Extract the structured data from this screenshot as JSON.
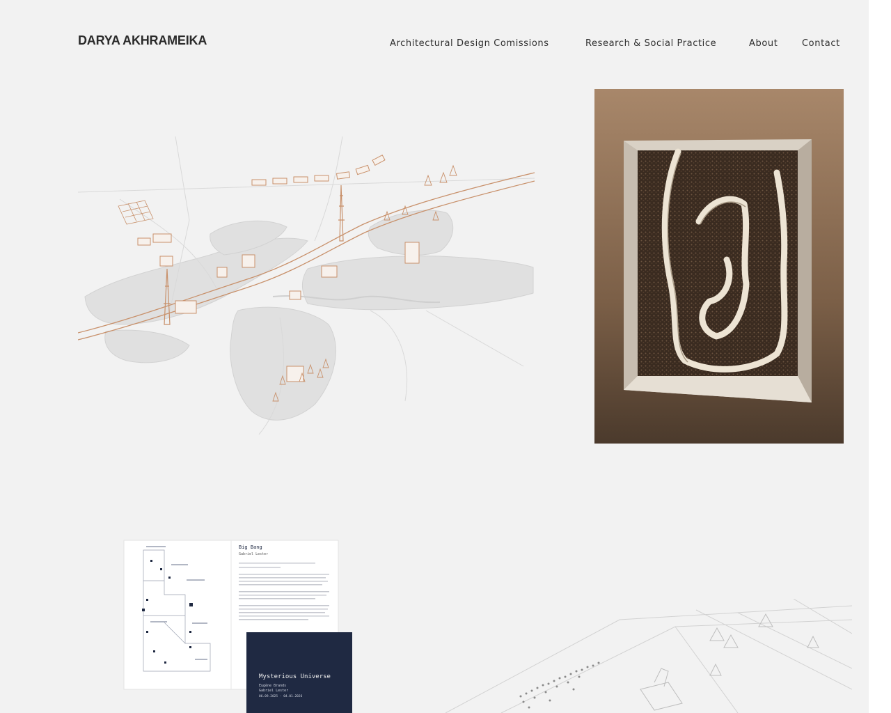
{
  "header": {
    "brand": "DARYA AKHRAMEIKA",
    "nav": [
      {
        "label": "Architectural Design Comissions"
      },
      {
        "label": "Research & Social Practice"
      },
      {
        "label": "About"
      },
      {
        "label": "Contact"
      }
    ]
  },
  "gallery": {
    "book": {
      "page_title": "Big Bang",
      "page_author": "Gabriel Lester",
      "cover_title": "Mysterious Universe",
      "cover_artists_1": "Eugène Brands",
      "cover_artists_2": "Gabriel Lester",
      "cover_dates": "06.09.2025 - 04.01.2026"
    }
  },
  "colors": {
    "background": "#f2f2f2",
    "accent_line": "#c8906a",
    "text": "#2b2b2b",
    "cover_navy": "#1f2942"
  }
}
